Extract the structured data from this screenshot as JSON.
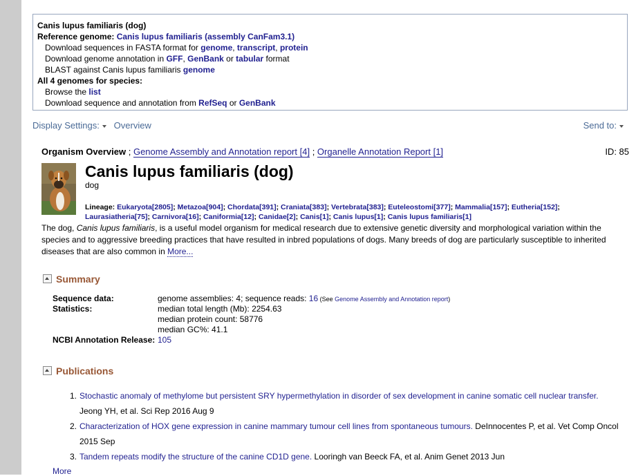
{
  "infobox": {
    "organism": "Canis lupus familiaris (dog)",
    "ref_label": "Reference genome: ",
    "ref_link": "Canis lupus familiaris (assembly CanFam3.1)",
    "dl_seq_prefix": "Download sequences in FASTA format for ",
    "dl_seq_links": [
      "genome",
      "transcript",
      "protein"
    ],
    "dl_ann_prefix": "Download genome annotation in ",
    "dl_ann_links": [
      "GFF",
      "GenBank",
      "tabular"
    ],
    "dl_ann_suffix": " format",
    "blast_prefix": "BLAST against Canis lupus familiaris ",
    "blast_link": "genome",
    "all_genomes": "All 4 genomes for species:",
    "browse_prefix": "Browse the ",
    "browse_link": "list",
    "dl_from_prefix": "Download sequence and annotation from ",
    "dl_from_links": [
      "RefSeq",
      "GenBank"
    ],
    "or": " or ",
    "comma": ", "
  },
  "toolbar": {
    "display_settings": "Display Settings:",
    "overview": "Overview",
    "send_to": "Send to:"
  },
  "overview_line": {
    "label": "Organism Overview",
    "sep": " ; ",
    "link1": "Genome Assembly and Annotation report [4]",
    "link2": "Organelle Annotation Report [1]",
    "id": "ID: 85"
  },
  "organism": {
    "title": "Canis lupus familiaris (dog)",
    "common": "dog",
    "lineage_label": "Lineage: ",
    "lineage": [
      "Eukaryota[2805]",
      "Metazoa[904]",
      "Chordata[391]",
      "Craniata[383]",
      "Vertebrata[383]",
      "Euteleostomi[377]",
      "Mammalia[157]",
      "Eutheria[152]",
      "Laurasiatheria[75]",
      "Carnivora[16]",
      "Caniformia[12]",
      "Canidae[2]",
      "Canis[1]",
      "Canis lupus[1]",
      "Canis lupus familiaris[1]"
    ],
    "desc_pre": "The dog, ",
    "desc_italic": "Canis lupus familiaris",
    "desc_post": ", is a useful model organism for medical research due to extensive genetic diversity and morphological variation within the species and to aggressive breeding practices that have resulted in inbred populations of dogs. Many breeds of dog are particularly susceptible to inherited diseases that are also common in ",
    "desc_more": "More..."
  },
  "summary": {
    "heading": "Summary",
    "seq_label": "Sequence data:",
    "seq_val_pre": "genome assemblies: 4; sequence reads: ",
    "seq_reads": "16",
    "seq_see": " (See ",
    "seq_see_link": "Genome Assembly and Annotation report",
    "seq_see_close": ")",
    "stats_label": "Statistics:",
    "stats": [
      "median total length (Mb): 2254.63",
      "median protein count: 58776",
      "median GC%: 41.1"
    ],
    "release_label": "NCBI Annotation Release:",
    "release_val": "105"
  },
  "publications": {
    "heading": "Publications",
    "items": [
      {
        "num": "1.",
        "title": "Stochastic anomaly of methylome but persistent SRY hypermethylation in disorder of sex development in canine somatic cell nuclear transfer.",
        "cite": " Jeong YH, et al. Sci Rep 2016 Aug 9"
      },
      {
        "num": "2.",
        "title": "Characterization of HOX gene expression in canine mammary tumour cell lines from spontaneous tumours.",
        "cite": " DeInnocentes P, et al. Vet Comp Oncol 2015 Sep"
      },
      {
        "num": "3.",
        "title": "Tandem repeats modify the structure of the canine CD1D gene.",
        "cite": " Looringh van Beeck FA, et al. Anim Genet 2013 Jun"
      }
    ],
    "more": "More"
  }
}
